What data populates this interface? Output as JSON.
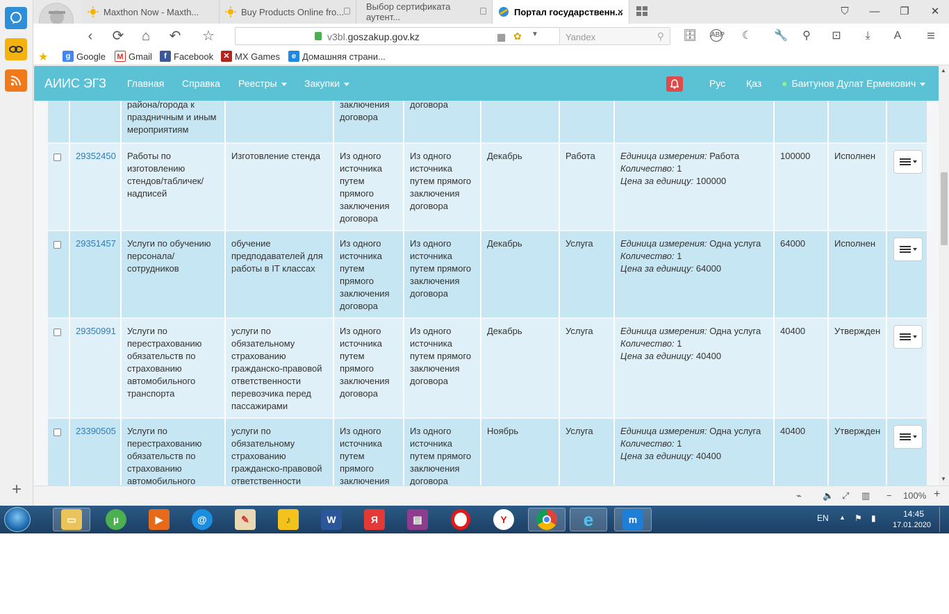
{
  "browser": {
    "tabs": [
      {
        "title": "Maxthon Now - Maxth...",
        "locked": false
      },
      {
        "title": "Buy Products Online fro...",
        "locked": true
      },
      {
        "title": "Выбор сертификата аутент...",
        "locked": true
      },
      {
        "title": "Портал государственн...",
        "locked": false,
        "active": true
      }
    ],
    "url_prefix": "v3bl.",
    "url_domain": "goszakup.gov.kz",
    "search_placeholder": "Yandex",
    "bookmarks": [
      {
        "label": "Google",
        "icon": "google-icon",
        "color": "#4285f4",
        "glyph": "g"
      },
      {
        "label": "Gmail",
        "icon": "gmail-icon",
        "color": "#d93025",
        "glyph": "M"
      },
      {
        "label": "Facebook",
        "icon": "facebook-icon",
        "color": "#3b5998",
        "glyph": "f"
      },
      {
        "label": "MX Games",
        "icon": "mx-games-icon",
        "color": "#b3261e",
        "glyph": "✕"
      },
      {
        "label": "Домашняя страни...",
        "icon": "ie-home-icon",
        "color": "#1e88e5",
        "glyph": "e"
      }
    ],
    "zoom": "100%"
  },
  "app": {
    "brand": "АИИС ЭГЗ",
    "nav": [
      "Главная",
      "Справка",
      "Реестры",
      "Закупки"
    ],
    "lang_ru": "Рус",
    "lang_kz": "Қаз",
    "user": "Баитунов Дулат Ермекович"
  },
  "table": {
    "partial_row": {
      "name": "района/города к праздничным и иным мероприятиям",
      "method": "заключения договора",
      "type": "договора"
    },
    "rows": [
      {
        "id": "29352450",
        "name": "Работы по изготовлению стендов/табличек/ надписей",
        "desc": "Изготовление стенда",
        "method": "Из одного источника путем прямого заключения договора",
        "subtype": "Из одного источника путем прямого заключения договора",
        "month": "Декабрь",
        "kind": "Работа",
        "unit_label": "Единица измерения:",
        "unit": "Работа",
        "qty_label": "Количество:",
        "qty": "1",
        "price_label": "Цена за единицу:",
        "price": "100000",
        "sum": "100000",
        "status": "Исполнен"
      },
      {
        "id": "29351457",
        "name": "Услуги по обучению персонала/ сотрудников",
        "desc": "обучение предподавателей для работы в IT классах",
        "method": "Из одного источника путем прямого заключения договора",
        "subtype": "Из одного источника путем прямого заключения договора",
        "month": "Декабрь",
        "kind": "Услуга",
        "unit_label": "Единица измерения:",
        "unit": "Одна услуга",
        "qty_label": "Количество:",
        "qty": "1",
        "price_label": "Цена за единицу:",
        "price": "64000",
        "sum": "64000",
        "status": "Исполнен"
      },
      {
        "id": "29350991",
        "name": "Услуги по перестрахованию обязательств по страхованию автомобильного транспорта",
        "desc": "услуги по обязательному страхованию гражданско-правовой ответственности перевозчика перед пассажирами",
        "method": "Из одного источника путем прямого заключения договора",
        "subtype": "Из одного источника путем прямого заключения договора",
        "month": "Декабрь",
        "kind": "Услуга",
        "unit_label": "Единица измерения:",
        "unit": "Одна услуга",
        "qty_label": "Количество:",
        "qty": "1",
        "price_label": "Цена за единицу:",
        "price": "40400",
        "sum": "40400",
        "status": "Утвержден"
      },
      {
        "id": "23390505",
        "name": "Услуги по перестрахованию обязательств по страхованию автомобильного",
        "desc": "услуги по обязательному страхованию гражданско-правовой ответственности",
        "method": "Из одного источника путем прямого заключения",
        "subtype": "Из одного источника путем прямого заключения договора",
        "month": "Ноябрь",
        "kind": "Услуга",
        "unit_label": "Единица измерения:",
        "unit": "Одна услуга",
        "qty_label": "Количество:",
        "qty": "1",
        "price_label": "Цена за единицу:",
        "price": "40400",
        "sum": "40400",
        "status": "Утвержден"
      }
    ]
  },
  "taskbar": {
    "lang": "EN",
    "time": "14:45",
    "date": "17.01.2020"
  },
  "colors": {
    "accent": "#5bc2d5",
    "link": "#337ab7",
    "row_a": "#c6e6f3",
    "row_b": "#dff0f8"
  }
}
